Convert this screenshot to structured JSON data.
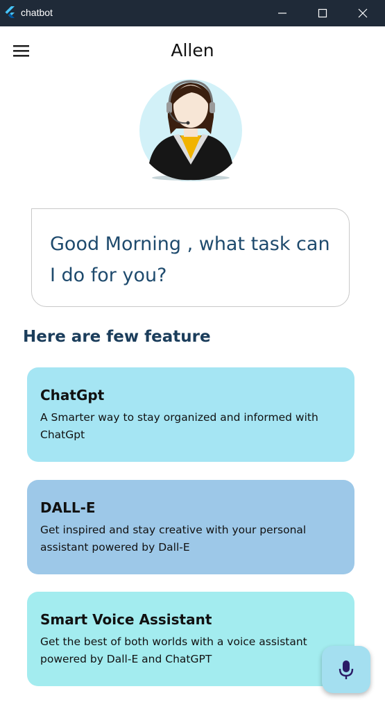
{
  "window": {
    "title": "chatbot",
    "icon": "flutter-icon",
    "controls": [
      "minimize-icon",
      "maximize-icon",
      "close-icon"
    ]
  },
  "appbar": {
    "title": "Allen",
    "menu_icon": "hamburger-menu-icon"
  },
  "avatar": {
    "icon": "assistant-avatar"
  },
  "greeting": {
    "text": "Good Morning , what task can I do for you?"
  },
  "features_heading": "Here are few feature",
  "features": [
    {
      "title": "ChatGpt",
      "description": "A Smarter way to stay organized and informed with ChatGpt",
      "color": "#a5e5f3"
    },
    {
      "title": "DALL-E",
      "description": "Get inspired and stay creative with your personal assistant powered by Dall-E",
      "color": "#9dc8e8"
    },
    {
      "title": "Smart Voice Assistant",
      "description": "Get the best of both worlds with a voice assistant powered by Dall-E and ChatGPT",
      "color": "#a3ecef"
    }
  ],
  "fab": {
    "icon": "microphone-icon",
    "color": "#a4dff0"
  },
  "colors": {
    "primary_text": "#1b3d5b",
    "titlebar": "#1f2a38",
    "avatar_bg": "#d2f1f8"
  }
}
